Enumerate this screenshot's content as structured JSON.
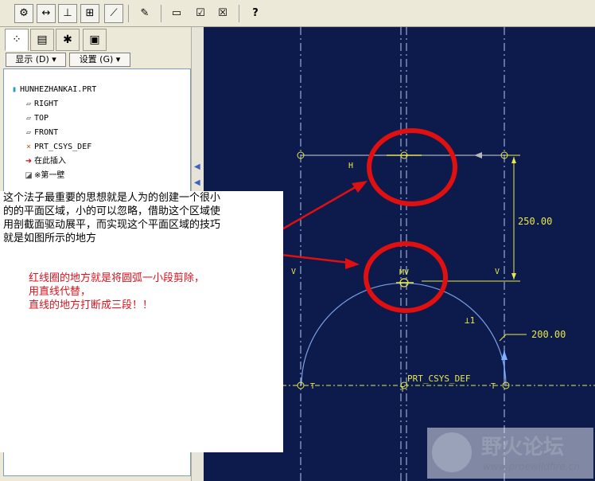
{
  "toolbar": {
    "help_glyph": "?"
  },
  "left_panel": {
    "display_menu": "显示 (D) ▾",
    "settings_menu": "设置 (G) ▾",
    "tree": {
      "root": "HUNHEZHANKAI.PRT",
      "items": [
        "RIGHT",
        "TOP",
        "FRONT",
        "PRT_CSYS_DEF",
        "在此插入",
        "※第一壁"
      ]
    }
  },
  "sketch": {
    "dim_vertical": "250.00",
    "dim_radius": "200.00",
    "csys_label": "PRT_CSYS_DEF",
    "constraints": {
      "h": "H",
      "v_left": "V",
      "v_right": "V",
      "mv": "MV",
      "perp": "⊥1",
      "t_left": "T",
      "t_right": "T",
      "t_center": "T"
    }
  },
  "annotation": {
    "black_lines": [
      "这个法子最重要的思想就是人为的创建一个很小",
      "的的平面区域，小的可以忽略，借助这个区域使",
      "用剖截面驱动展平，而实现这个平面区域的技巧",
      "就是如图所示的地方"
    ],
    "red_lines": [
      "红线圈的地方就是将圆弧一小段剪除，",
      "用直线代替，",
      "直线的地方打断成三段！！"
    ]
  },
  "watermark": {
    "title": "野火论坛",
    "url": "www.proewildfire.cn"
  },
  "colors": {
    "canvas_bg": "#0c1a4c",
    "sketch_yellow": "#e8e84a",
    "arc_blue": "#7f9fe0",
    "annotation_red": "#d9141f",
    "dim_arrow_gray": "#b8b8b8"
  }
}
